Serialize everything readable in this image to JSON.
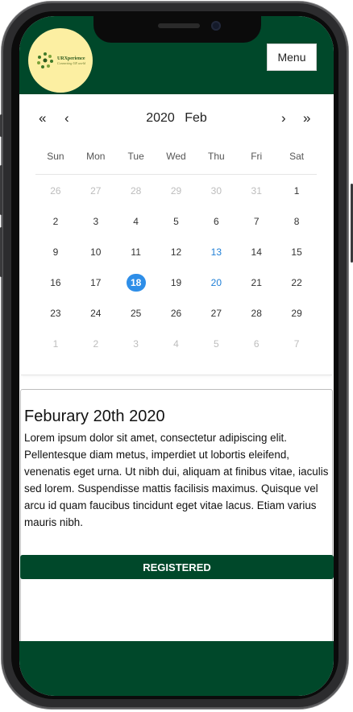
{
  "header": {
    "logo_title": "URXperience",
    "logo_tagline": "Connecting UR world",
    "menu_label": "Menu"
  },
  "calendar": {
    "prev_year": "«",
    "prev_month": "‹",
    "year": "2020",
    "month": "Feb",
    "next_month": "›",
    "next_year": "»",
    "weekdays": [
      "Sun",
      "Mon",
      "Tue",
      "Wed",
      "Thu",
      "Fri",
      "Sat"
    ],
    "weeks": [
      [
        {
          "d": "26",
          "o": true
        },
        {
          "d": "27",
          "o": true
        },
        {
          "d": "28",
          "o": true
        },
        {
          "d": "29",
          "o": true
        },
        {
          "d": "30",
          "o": true
        },
        {
          "d": "31",
          "o": true
        },
        {
          "d": "1"
        }
      ],
      [
        {
          "d": "2"
        },
        {
          "d": "3"
        },
        {
          "d": "4"
        },
        {
          "d": "5"
        },
        {
          "d": "6"
        },
        {
          "d": "7"
        },
        {
          "d": "8"
        }
      ],
      [
        {
          "d": "9"
        },
        {
          "d": "10"
        },
        {
          "d": "11"
        },
        {
          "d": "12"
        },
        {
          "d": "13",
          "e": true
        },
        {
          "d": "14"
        },
        {
          "d": "15"
        }
      ],
      [
        {
          "d": "16"
        },
        {
          "d": "17"
        },
        {
          "d": "18",
          "s": true
        },
        {
          "d": "19"
        },
        {
          "d": "20",
          "e": true
        },
        {
          "d": "21"
        },
        {
          "d": "22"
        }
      ],
      [
        {
          "d": "23"
        },
        {
          "d": "24"
        },
        {
          "d": "25"
        },
        {
          "d": "26"
        },
        {
          "d": "27"
        },
        {
          "d": "28"
        },
        {
          "d": "29"
        }
      ],
      [
        {
          "d": "1",
          "o": true
        },
        {
          "d": "2",
          "o": true
        },
        {
          "d": "3",
          "o": true
        },
        {
          "d": "4",
          "o": true
        },
        {
          "d": "5",
          "o": true
        },
        {
          "d": "6",
          "o": true
        },
        {
          "d": "7",
          "o": true
        }
      ]
    ]
  },
  "event": {
    "title": "Feburary 20th 2020",
    "body": "Lorem ipsum dolor sit amet, consectetur adipiscing elit. Pellentesque diam metus, imperdiet ut lobortis eleifend, venenatis eget urna. Ut nibh dui, aliquam at finibus vitae, iaculis sed lorem. Suspendisse mattis facilisis maximus.  Quisque vel arcu id quam faucibus tincidunt eget vitae lacus. Etiam varius mauris nibh.",
    "button_label": "REGISTERED"
  },
  "colors": {
    "brand_green": "#00482a",
    "selected_day": "#2e8ee8",
    "event_day": "#1f7fd6",
    "logo_bg": "#fcefa2"
  }
}
